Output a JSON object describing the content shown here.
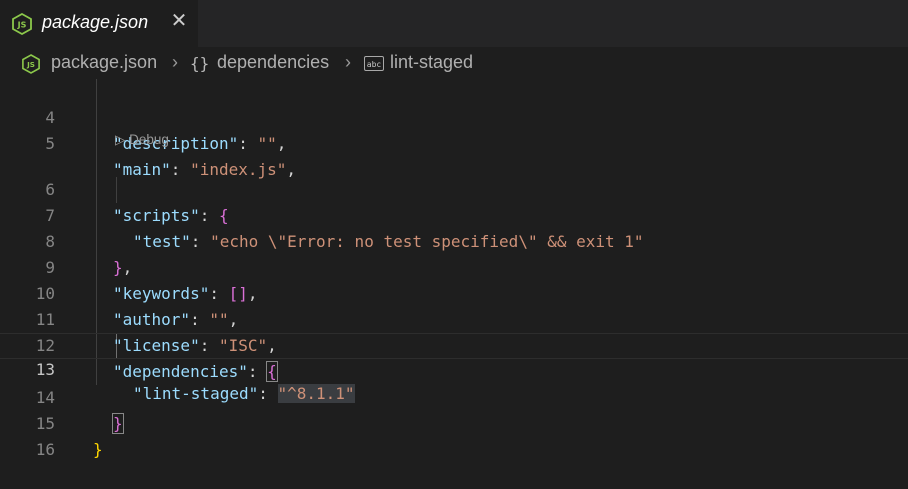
{
  "tab": {
    "title": "package.json",
    "icon": "nodejs-icon",
    "close_glyph": "✕"
  },
  "breadcrumb": {
    "file": "package.json",
    "sep": "›",
    "braces": "{}",
    "item1": "dependencies",
    "string_icon_label": "abc",
    "item2": "lint-staged"
  },
  "codelens": {
    "label": "▷ Debug"
  },
  "line_numbers": [
    "4",
    "5",
    "6",
    "7",
    "8",
    "9",
    "10",
    "11",
    "12",
    "13",
    "14",
    "15",
    "16"
  ],
  "code": {
    "l4": {
      "key": "\"description\"",
      "colon": ": ",
      "val": "\"\"",
      "end": ","
    },
    "l5": {
      "key": "\"main\"",
      "colon": ": ",
      "val": "\"index.js\"",
      "end": ","
    },
    "l6": {
      "key": "\"scripts\"",
      "colon": ": ",
      "brace": "{"
    },
    "l7": {
      "key": "\"test\"",
      "colon": ": ",
      "val": "\"echo \\\"Error: no test specified\\\" && exit 1\""
    },
    "l8": {
      "brace": "}",
      "end": ","
    },
    "l9": {
      "key": "\"keywords\"",
      "colon": ": ",
      "brace": "[]",
      "end": ","
    },
    "l10": {
      "key": "\"author\"",
      "colon": ": ",
      "val": "\"\"",
      "end": ","
    },
    "l11": {
      "key": "\"license\"",
      "colon": ": ",
      "val": "\"ISC\"",
      "end": ","
    },
    "l12": {
      "key": "\"dependencies\"",
      "colon": ": ",
      "brace": "{"
    },
    "l13": {
      "key": "\"lint-staged\"",
      "colon": ": ",
      "val": "\"^8.1.1\""
    },
    "l14": {
      "brace": "}"
    },
    "l15": {
      "brace": "}"
    }
  },
  "colors": {
    "key": "#9cdcfe",
    "string": "#ce9178",
    "brace_outer": "#ffd700",
    "brace_inner": "#da70d6",
    "nodejs_green": "#8cc84b"
  }
}
